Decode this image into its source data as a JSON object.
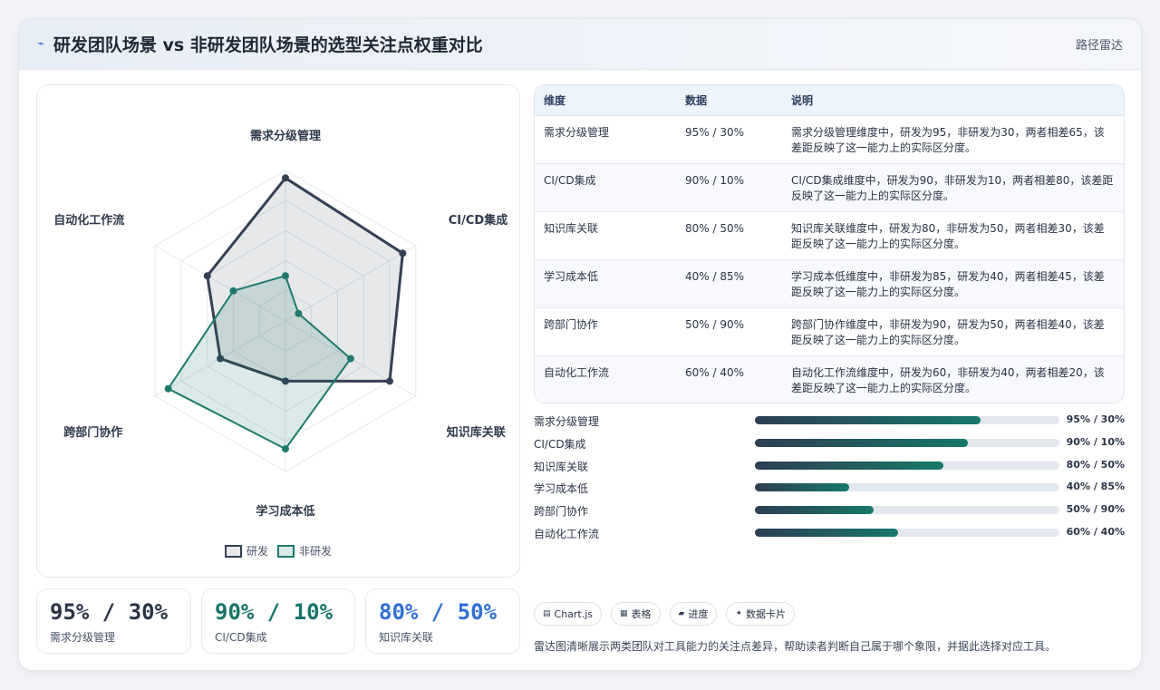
{
  "header": {
    "title": "研发团队场景 vs 非研发团队场景的选型关注点权重对比",
    "right_label": "路径雷达"
  },
  "chart_data": {
    "type": "radar",
    "categories": [
      "需求分级管理",
      "CI/CD集成",
      "知识库关联",
      "学习成本低",
      "跨部门协作",
      "自动化工作流"
    ],
    "series": [
      {
        "name": "研发",
        "values": [
          95,
          90,
          80,
          40,
          50,
          60
        ],
        "color": "#344054"
      },
      {
        "name": "非研发",
        "values": [
          30,
          10,
          50,
          85,
          90,
          40
        ],
        "color": "#1f7a6d"
      }
    ],
    "rlim": [
      0,
      100
    ],
    "legend_position": "bottom"
  },
  "stats": [
    {
      "value": "95% / 30%",
      "label": "需求分级管理",
      "color": "#2b3446"
    },
    {
      "value": "90% / 10%",
      "label": "CI/CD集成",
      "color": "#17756a"
    },
    {
      "value": "80% / 50%",
      "label": "知识库关联",
      "color": "#2f6fd6"
    }
  ],
  "table": {
    "headers": [
      "维度",
      "数据",
      "说明"
    ],
    "rows": [
      {
        "dim": "需求分级管理",
        "data": "95% / 30%",
        "desc": "需求分级管理维度中，研发为95，非研发为30，两者相差65，该差距反映了这一能力上的实际区分度。"
      },
      {
        "dim": "CI/CD集成",
        "data": "90% / 10%",
        "desc": "CI/CD集成维度中，研发为90，非研发为10，两者相差80，该差距反映了这一能力上的实际区分度。"
      },
      {
        "dim": "知识库关联",
        "data": "80% / 50%",
        "desc": "知识库关联维度中，研发为80，非研发为50，两者相差30，该差距反映了这一能力上的实际区分度。"
      },
      {
        "dim": "学习成本低",
        "data": "40% / 85%",
        "desc": "学习成本低维度中，非研发为85，研发为40，两者相差45，该差距反映了这一能力上的实际区分度。"
      },
      {
        "dim": "跨部门协作",
        "data": "50% / 90%",
        "desc": "跨部门协作维度中，非研发为90，研发为50，两者相差40，该差距反映了这一能力上的实际区分度。"
      },
      {
        "dim": "自动化工作流",
        "data": "60% / 40%",
        "desc": "自动化工作流维度中，研发为60，非研发为40，两者相差20，该差距反映了这一能力上的实际区分度。"
      }
    ]
  },
  "bars": [
    {
      "label": "需求分级管理",
      "value": 74,
      "text": "95% / 30%"
    },
    {
      "label": "CI/CD集成",
      "value": 70,
      "text": "90% / 10%"
    },
    {
      "label": "知识库关联",
      "value": 62,
      "text": "80% / 50%"
    },
    {
      "label": "学习成本低",
      "value": 31,
      "text": "40% / 85%"
    },
    {
      "label": "跨部门协作",
      "value": 39,
      "text": "50% / 90%"
    },
    {
      "label": "自动化工作流",
      "value": 47,
      "text": "60% / 40%"
    }
  ],
  "tags": [
    {
      "icon": "▤",
      "label": "Chart.js",
      "icon_name": "chart-icon"
    },
    {
      "icon": "▦",
      "label": "表格",
      "icon_name": "table-icon"
    },
    {
      "icon": "▰",
      "label": "进度",
      "icon_name": "progress-icon"
    },
    {
      "icon": "✦",
      "label": "数据卡片",
      "icon_name": "card-icon"
    }
  ],
  "note": "雷达图清晰展示两类团队对工具能力的关注点差异，帮助读者判断自己属于哪个象限，并据此选择对应工具。"
}
